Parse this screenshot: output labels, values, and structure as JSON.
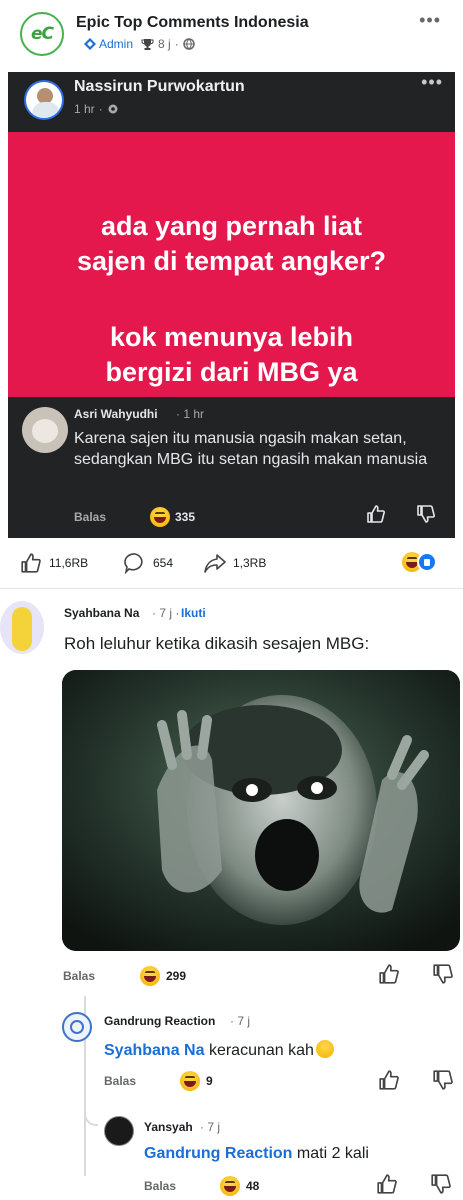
{
  "header": {
    "group_name": "Epic Top Comments Indonesia",
    "role_badge": "Admin",
    "time": "8 j",
    "logo_text": "eC"
  },
  "shared_post": {
    "author": "Nassirun Purwokartun",
    "time": "1 hr",
    "text_lines": [
      "ada yang pernah liat",
      "sajen di tempat angker?",
      "kok menunya lebih",
      "bergizi dari MBG ya"
    ],
    "comment": {
      "author": "Asri Wahyudhi",
      "time": "1 hr",
      "text": "Karena sajen itu manusia ngasih makan setan, sedangkan MBG itu setan ngasih makan manusia",
      "reply_label": "Balas",
      "reaction_count": "335"
    }
  },
  "post_stats": {
    "likes": "11,6RB",
    "comments": "654",
    "shares": "1,3RB"
  },
  "comments": [
    {
      "author": "Syahbana Na",
      "time": "7 j",
      "follow_label": "Ikuti",
      "text": "Roh leluhur ketika dikasih sesajen MBG:",
      "reply_label": "Balas",
      "reaction_count": "299",
      "replies": [
        {
          "author": "Gandrung Reaction",
          "time": "7 j",
          "mention": "Syahbana Na",
          "text": "keracunan kah",
          "reply_label": "Balas",
          "reaction_count": "9"
        },
        {
          "author": "Yansyah",
          "time": "7 j",
          "mention": "Gandrung Reaction",
          "text": "mati 2 kali",
          "reply_label": "Balas",
          "reaction_count": "48"
        }
      ]
    }
  ],
  "colors": {
    "accent_blue": "#1a6ed8",
    "red_panel": "#e4184d",
    "dark_card": "#222324"
  }
}
